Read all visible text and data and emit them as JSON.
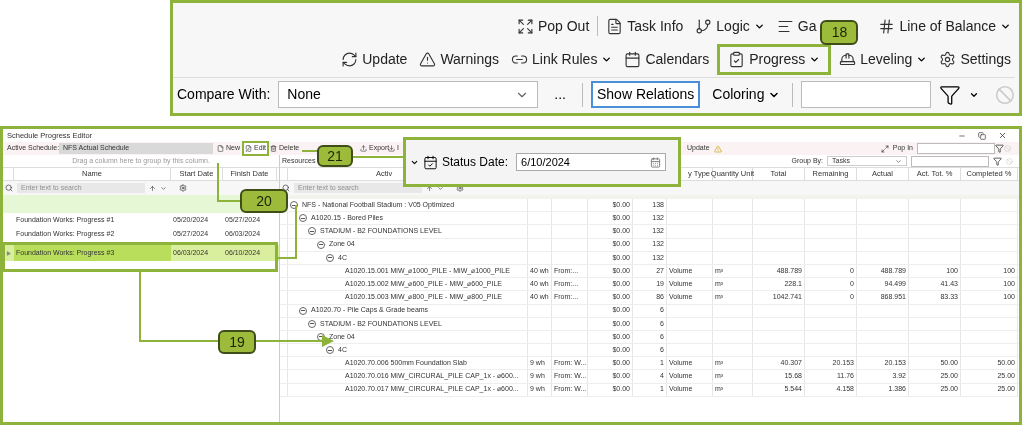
{
  "toolbar_callout": {
    "badge": "18",
    "row_1": [
      {
        "label": "Pop Out",
        "dropdown": false
      },
      {
        "label": "Task Info",
        "dropdown": false
      },
      {
        "label": "Logic",
        "dropdown": true
      },
      {
        "label": "Ga",
        "dropdown": false
      },
      {
        "label": "Line of Balance",
        "dropdown": true
      }
    ],
    "row_2": [
      {
        "label": "Update",
        "dropdown": false,
        "highlighted": false
      },
      {
        "label": "Warnings",
        "dropdown": false,
        "highlighted": false
      },
      {
        "label": "Link Rules",
        "dropdown": true,
        "highlighted": false
      },
      {
        "label": "Calendars",
        "dropdown": false,
        "highlighted": false
      },
      {
        "label": "Progress",
        "dropdown": true,
        "highlighted": true
      },
      {
        "label": "Leveling",
        "dropdown": true,
        "highlighted": false
      },
      {
        "label": "Settings",
        "dropdown": false,
        "highlighted": false
      }
    ],
    "compare_label": "Compare With:",
    "compare_value": "None",
    "more": "...",
    "show_relations": "Show Relations",
    "coloring": "Coloring"
  },
  "window": {
    "title": "Schedule Progress Editor",
    "active_schedule_label": "Active Schedule:",
    "active_schedule": "NFS Actual Schedule",
    "toolbar": [
      {
        "label": "New",
        "highlighted": false
      },
      {
        "label": "Edit",
        "highlighted": true
      },
      {
        "label": "Delete",
        "highlighted": false
      },
      {
        "label": "Export",
        "highlighted": false
      },
      {
        "label": "I",
        "highlighted": false
      }
    ],
    "update": "Update",
    "pop_in": "Pop In",
    "resources": "Resources",
    "group_by_label": "Group By:",
    "group_by": "Tasks"
  },
  "status_date": {
    "label": "Status Date:",
    "value": "6/10/2024"
  },
  "left_grid": {
    "group_hint": "Drag a column here to group by this column.",
    "columns": [
      "Name",
      "Start Date",
      "Finish Date"
    ],
    "search_placeholder": "Enter text to search",
    "rows": [
      {
        "name": "Foundation Works: Progress #1",
        "start": "05/20/2024",
        "finish": "05/27/2024",
        "selected": false
      },
      {
        "name": "Foundation Works: Progress #2",
        "start": "05/27/2024",
        "finish": "06/03/2024",
        "selected": false
      },
      {
        "name": "Foundation Works: Progress #3",
        "start": "06/03/2024",
        "finish": "06/10/2024",
        "selected": true
      }
    ]
  },
  "right_grid": {
    "columns": [
      "Activ",
      "y Type",
      "Quantity Unit",
      "Total",
      "Remaining",
      "Actual",
      "Act. Tot. %",
      "Completed %"
    ],
    "search_placeholder": "Enter text to search",
    "rows": [
      {
        "name": "NFS - National Football Stadium : V05 Optimized",
        "expanded": true,
        "cost": "$0.00",
        "count": "138",
        "children": [
          {
            "name": "A1020.15 - Bored Piles",
            "expanded": true,
            "cost": "$0.00",
            "count": "132",
            "children": [
              {
                "name": "STADIUM - B2 FOUNDATIONS LEVEL",
                "expanded": true,
                "cost": "$0.00",
                "count": "132",
                "children": [
                  {
                    "name": "Zone 04",
                    "expanded": true,
                    "cost": "$0.00",
                    "count": "132",
                    "children": [
                      {
                        "name": "4C",
                        "expanded": true,
                        "cost": "$0.00",
                        "count": "132",
                        "children": [
                          {
                            "name": "A1020.15.001 MiW_⌀1000_PILE - MiW_⌀1000_PILE",
                            "hours": "40 wh",
                            "from": "From:...",
                            "cost": "$0.00",
                            "count": "27",
                            "type": "Volume",
                            "unit": "m³",
                            "total": "488.789",
                            "remaining": "0",
                            "actual": "488.789",
                            "act_tot_pct": "100",
                            "completed_pct": "100"
                          },
                          {
                            "name": "A1020.15.002 MiW_⌀600_PILE - MiW_⌀600_PILE",
                            "hours": "40 wh",
                            "from": "From:...",
                            "cost": "$0.00",
                            "count": "19",
                            "type": "Volume",
                            "unit": "m³",
                            "total": "228.1",
                            "remaining": "0",
                            "actual": "94.499",
                            "act_tot_pct": "41.43",
                            "completed_pct": "100"
                          },
                          {
                            "name": "A1020.15.003 MiW_⌀800_PILE - MiW_⌀800_PILE",
                            "hours": "40 wh",
                            "from": "From:...",
                            "cost": "$0.00",
                            "count": "86",
                            "type": "Volume",
                            "unit": "m³",
                            "total": "1042.741",
                            "remaining": "0",
                            "actual": "868.951",
                            "act_tot_pct": "83.33",
                            "completed_pct": "100"
                          }
                        ]
                      }
                    ]
                  }
                ]
              }
            ]
          },
          {
            "name": "A1020.70 - Pile Caps & Grade beams",
            "expanded": true,
            "cost": "$0.00",
            "count": "6",
            "children": [
              {
                "name": "STADIUM - B2 FOUNDATIONS LEVEL",
                "expanded": true,
                "cost": "$0.00",
                "count": "6",
                "children": [
                  {
                    "name": "Zone 04",
                    "expanded": true,
                    "cost": "$0.00",
                    "count": "6",
                    "children": [
                      {
                        "name": "4C",
                        "expanded": true,
                        "cost": "$0.00",
                        "count": "6",
                        "children": [
                          {
                            "name": "A1020.70.006 500mm Foundation Slab",
                            "hours": "9 wh",
                            "from": "From: W...",
                            "cost": "$0.00",
                            "count": "1",
                            "type": "Volume",
                            "unit": "m³",
                            "total": "40.307",
                            "remaining": "20.153",
                            "actual": "20.153",
                            "act_tot_pct": "50.00",
                            "completed_pct": "50.00"
                          },
                          {
                            "name": "A1020.70.016 MiW_CIRCURAL_PILE CAP_1x - ⌀600...",
                            "hours": "9 wh",
                            "from": "From: W...",
                            "cost": "$0.00",
                            "count": "4",
                            "type": "Volume",
                            "unit": "m³",
                            "total": "15.68",
                            "remaining": "11.76",
                            "actual": "3.92",
                            "act_tot_pct": "25.00",
                            "completed_pct": "25.00"
                          },
                          {
                            "name": "A1020.70.017 MiW_CIRCURAL_PILE CAP_1x - ⌀600...",
                            "hours": "9 wh",
                            "from": "From: W...",
                            "cost": "$0.00",
                            "count": "1",
                            "type": "Volume",
                            "unit": "m³",
                            "total": "5.544",
                            "remaining": "4.158",
                            "actual": "1.386",
                            "act_tot_pct": "25.00",
                            "completed_pct": "25.00"
                          }
                        ]
                      }
                    ]
                  }
                ]
              }
            ]
          }
        ]
      }
    ]
  },
  "annotations": [
    {
      "label": "19"
    },
    {
      "label": "20"
    },
    {
      "label": "21"
    }
  ]
}
